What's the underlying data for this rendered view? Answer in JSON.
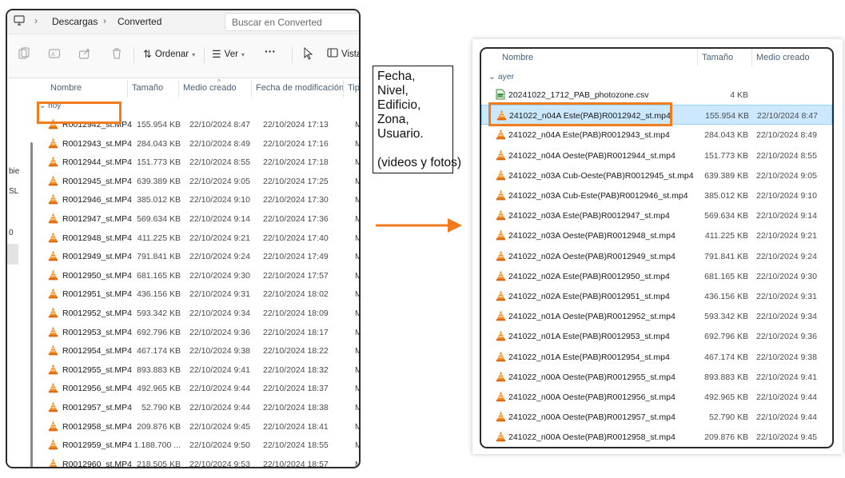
{
  "left_window": {
    "breadcrumb": [
      "Descargas",
      "Converted"
    ],
    "search_placeholder": "Buscar en Converted",
    "toolbar": {
      "sort_label": "Ordenar",
      "view_label": "Ver",
      "more_label": "···",
      "view_partial_label": "Vista"
    },
    "columns": [
      "Nombre",
      "Tamaño",
      "Medio creado",
      "Fecha de modificación",
      "Tip"
    ],
    "group_label": "hoy",
    "nav_fragments": [
      "bie",
      "SL",
      "0"
    ],
    "files": [
      {
        "name": "R0012942_st.MP4",
        "size": "155.954 KB",
        "media_created": "22/10/2024 8:47",
        "modified": "22/10/2024 17:13",
        "type": "MP"
      },
      {
        "name": "R0012943_st.MP4",
        "size": "284.043 KB",
        "media_created": "22/10/2024 8:49",
        "modified": "22/10/2024 17:16",
        "type": "MP"
      },
      {
        "name": "R0012944_st.MP4",
        "size": "151.773 KB",
        "media_created": "22/10/2024 8:55",
        "modified": "22/10/2024 17:18",
        "type": "MP"
      },
      {
        "name": "R0012945_st.MP4",
        "size": "639.389 KB",
        "media_created": "22/10/2024 9:05",
        "modified": "22/10/2024 17:25",
        "type": "MP"
      },
      {
        "name": "R0012946_st.MP4",
        "size": "385.012 KB",
        "media_created": "22/10/2024 9:10",
        "modified": "22/10/2024 17:30",
        "type": "MP"
      },
      {
        "name": "R0012947_st.MP4",
        "size": "569.634 KB",
        "media_created": "22/10/2024 9:14",
        "modified": "22/10/2024 17:36",
        "type": "MP"
      },
      {
        "name": "R0012948_st.MP4",
        "size": "411.225 KB",
        "media_created": "22/10/2024 9:21",
        "modified": "22/10/2024 17:40",
        "type": "MP"
      },
      {
        "name": "R0012949_st.MP4",
        "size": "791.841 KB",
        "media_created": "22/10/2024 9:24",
        "modified": "22/10/2024 17:49",
        "type": "MP"
      },
      {
        "name": "R0012950_st.MP4",
        "size": "681.165 KB",
        "media_created": "22/10/2024 9:30",
        "modified": "22/10/2024 17:57",
        "type": "MP"
      },
      {
        "name": "R0012951_st.MP4",
        "size": "436.156 KB",
        "media_created": "22/10/2024 9:31",
        "modified": "22/10/2024 18:02",
        "type": "MP"
      },
      {
        "name": "R0012952_st.MP4",
        "size": "593.342 KB",
        "media_created": "22/10/2024 9:34",
        "modified": "22/10/2024 18:09",
        "type": "MP"
      },
      {
        "name": "R0012953_st.MP4",
        "size": "692.796 KB",
        "media_created": "22/10/2024 9:36",
        "modified": "22/10/2024 18:17",
        "type": "MP"
      },
      {
        "name": "R0012954_st.MP4",
        "size": "467.174 KB",
        "media_created": "22/10/2024 9:38",
        "modified": "22/10/2024 18:22",
        "type": "MP"
      },
      {
        "name": "R0012955_st.MP4",
        "size": "893.883 KB",
        "media_created": "22/10/2024 9:41",
        "modified": "22/10/2024 18:32",
        "type": "MP"
      },
      {
        "name": "R0012956_st.MP4",
        "size": "492.965 KB",
        "media_created": "22/10/2024 9:44",
        "modified": "22/10/2024 18:37",
        "type": "MP"
      },
      {
        "name": "R0012957_st.MP4",
        "size": "52.790 KB",
        "media_created": "22/10/2024 9:44",
        "modified": "22/10/2024 18:38",
        "type": "MP"
      },
      {
        "name": "R0012958_st.MP4",
        "size": "209.876 KB",
        "media_created": "22/10/2024 9:45",
        "modified": "22/10/2024 18:41",
        "type": "MP"
      },
      {
        "name": "R0012959_st.MP4",
        "size": "1.188.700 ...",
        "media_created": "22/10/2024 9:50",
        "modified": "22/10/2024 18:55",
        "type": "MP"
      },
      {
        "name": "R0012960_st.MP4",
        "size": "218.505 KB",
        "media_created": "22/10/2024 9:53",
        "modified": "22/10/2024 18:57",
        "type": "MP"
      }
    ]
  },
  "note": {
    "lines": [
      "Fecha,",
      "Nivel,",
      "Edificio,",
      "Zona,",
      "Usuario."
    ],
    "footer": "(videos y fotos)"
  },
  "right_window": {
    "columns": [
      "Nombre",
      "Tamaño",
      "Medio creado"
    ],
    "group_label": "ayer",
    "files": [
      {
        "name": "20241022_1712_PAB_photozone.csv",
        "size": "4 KB",
        "media_created": "",
        "icon": "csv-file-icon"
      },
      {
        "name": "241022_n04A Este(PAB)R0012942_st.mp4",
        "size": "155.954 KB",
        "media_created": "22/10/2024 8:47",
        "icon": "vlc-icon",
        "selected": true
      },
      {
        "name": "241022_n04A Este(PAB)R0012943_st.mp4",
        "size": "284.043 KB",
        "media_created": "22/10/2024 8:49",
        "icon": "vlc-icon"
      },
      {
        "name": "241022_n04A Oeste(PAB)R0012944_st.mp4",
        "size": "151.773 KB",
        "media_created": "22/10/2024 8:55",
        "icon": "vlc-icon"
      },
      {
        "name": "241022_n03A Cub-Oeste(PAB)R0012945_st.mp4",
        "size": "639.389 KB",
        "media_created": "22/10/2024 9:05",
        "icon": "vlc-icon"
      },
      {
        "name": "241022_n03A Cub-Este(PAB)R0012946_st.mp4",
        "size": "385.012 KB",
        "media_created": "22/10/2024 9:10",
        "icon": "vlc-icon"
      },
      {
        "name": "241022_n03A Este(PAB)R0012947_st.mp4",
        "size": "569.634 KB",
        "media_created": "22/10/2024 9:14",
        "icon": "vlc-icon"
      },
      {
        "name": "241022_n03A Oeste(PAB)R0012948_st.mp4",
        "size": "411.225 KB",
        "media_created": "22/10/2024 9:21",
        "icon": "vlc-icon"
      },
      {
        "name": "241022_n02A Oeste(PAB)R0012949_st.mp4",
        "size": "791.841 KB",
        "media_created": "22/10/2024 9:24",
        "icon": "vlc-icon"
      },
      {
        "name": "241022_n02A Este(PAB)R0012950_st.mp4",
        "size": "681.165 KB",
        "media_created": "22/10/2024 9:30",
        "icon": "vlc-icon"
      },
      {
        "name": "241022_n02A Este(PAB)R0012951_st.mp4",
        "size": "436.156 KB",
        "media_created": "22/10/2024 9:31",
        "icon": "vlc-icon"
      },
      {
        "name": "241022_n01A Oeste(PAB)R0012952_st.mp4",
        "size": "593.342 KB",
        "media_created": "22/10/2024 9:34",
        "icon": "vlc-icon"
      },
      {
        "name": "241022_n01A Este(PAB)R0012953_st.mp4",
        "size": "692.796 KB",
        "media_created": "22/10/2024 9:36",
        "icon": "vlc-icon"
      },
      {
        "name": "241022_n01A Este(PAB)R0012954_st.mp4",
        "size": "467.174 KB",
        "media_created": "22/10/2024 9:38",
        "icon": "vlc-icon"
      },
      {
        "name": "241022_n00A Oeste(PAB)R0012955_st.mp4",
        "size": "893.883 KB",
        "media_created": "22/10/2024 9:41",
        "icon": "vlc-icon"
      },
      {
        "name": "241022_n00A Oeste(PAB)R0012956_st.mp4",
        "size": "492.965 KB",
        "media_created": "22/10/2024 9:44",
        "icon": "vlc-icon"
      },
      {
        "name": "241022_n00A Oeste(PAB)R0012957_st.mp4",
        "size": "52.790 KB",
        "media_created": "22/10/2024 9:44",
        "icon": "vlc-icon"
      },
      {
        "name": "241022_n00A Oeste(PAB)R0012958_st.mp4",
        "size": "209.876 KB",
        "media_created": "22/10/2024 9:45",
        "icon": "vlc-icon"
      }
    ]
  },
  "colors": {
    "highlight_orange": "#f07c1e",
    "arrow_orange": "#f07c1e",
    "selection_blue": "#cce8ff"
  }
}
